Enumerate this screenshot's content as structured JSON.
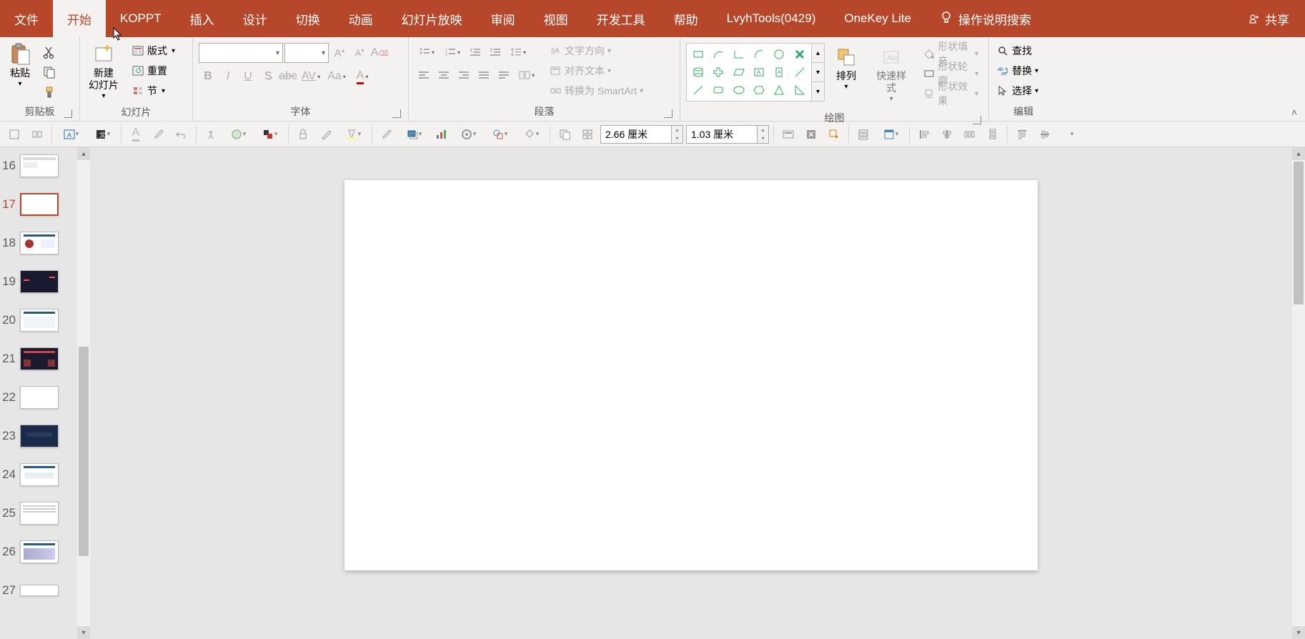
{
  "tabs": {
    "file": "文件",
    "home": "开始",
    "koppt": "KOPPT",
    "insert": "插入",
    "design": "设计",
    "transitions": "切换",
    "animations": "动画",
    "slideshow": "幻灯片放映",
    "review": "审阅",
    "view": "视图",
    "developer": "开发工具",
    "help": "帮助",
    "lvyh": "LvyhTools(0429)",
    "onekey": "OneKey Lite",
    "tellme": "操作说明搜索",
    "share": "共享"
  },
  "groups": {
    "clipboard": {
      "label": "剪贴板",
      "paste": "粘贴"
    },
    "slides": {
      "label": "幻灯片",
      "newslide": "新建\n幻灯片",
      "layout": "版式",
      "reset": "重置",
      "section": "节"
    },
    "font": {
      "label": "字体"
    },
    "paragraph": {
      "label": "段落",
      "textdir": "文字方向",
      "align": "对齐文本",
      "smartart": "转换为 SmartArt"
    },
    "drawing": {
      "label": "绘图",
      "arrange": "排列",
      "quickstyle": "快速样式",
      "shapefill": "形状填充",
      "shapeoutline": "形状轮廓",
      "shapeeffects": "形状效果"
    },
    "editing": {
      "label": "编辑",
      "find": "查找",
      "replace": "替换",
      "select": "选择"
    }
  },
  "toolbar2": {
    "width": "2.66 厘米",
    "height": "1.03 厘米"
  },
  "slides_panel": {
    "numbers": [
      "16",
      "17",
      "18",
      "19",
      "20",
      "21",
      "22",
      "23",
      "24",
      "25",
      "26",
      "27"
    ],
    "active": "17"
  }
}
